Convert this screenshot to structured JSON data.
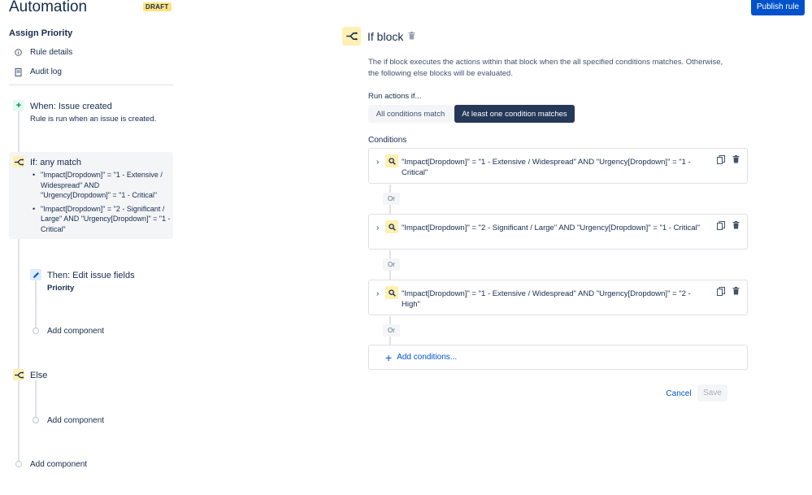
{
  "header": {
    "title": "Automation",
    "badge": "DRAFT",
    "publish_label": "Publish rule"
  },
  "sidebar": {
    "rule_name": "Assign Priority",
    "nav": [
      {
        "label": "Rule details",
        "icon": "info-icon"
      },
      {
        "label": "Audit log",
        "icon": "document-icon"
      }
    ]
  },
  "flow": {
    "trigger": {
      "title": "When: Issue created",
      "subtitle": "Rule is run when an issue is created."
    },
    "if_block": {
      "title": "If: any match",
      "conditions": [
        "\"Impact[Dropdown]\" = \"1 - Extensive / Widespread\" AND \"Urgency[Dropdown]\" = \"1 - Critical\"",
        "\"Impact[Dropdown]\" = \"2 - Significant / Large\" AND \"Urgency[Dropdown]\" = \"1 - Critical\""
      ]
    },
    "action": {
      "title": "Then: Edit issue fields",
      "subtitle": "Priority"
    },
    "add_component_1": "Add component",
    "else_title": "Else",
    "add_component_2": "Add component",
    "add_component_3": "Add component"
  },
  "panel": {
    "title": "If block",
    "description": "The if block executes the actions within that block when the all specified conditions matches. Otherwise, the following else blocks will be evaluated.",
    "run_label": "Run actions if...",
    "options": [
      "All conditions match",
      "At least one condition matches"
    ],
    "selected_option": "At least one condition matches",
    "conditions_label": "Conditions",
    "conditions": [
      "\"Impact[Dropdown]\" = \"1 - Extensive / Widespread\" AND \"Urgency[Dropdown]\" = \"1 - Critical\"",
      "\"Impact[Dropdown]\" = \"2 - Significant / Large\" AND \"Urgency[Dropdown]\" = \"1 - Critical\"",
      "\"Impact[Dropdown]\" = \"1 - Extensive / Widespread\" AND \"Urgency[Dropdown]\" = \"2 - High\""
    ],
    "or_label": "Or",
    "add_conditions": "Add conditions...",
    "cancel": "Cancel",
    "save": "Save"
  },
  "colors": {
    "primary": "#0052cc",
    "selected_segment": "#253858",
    "condition_icon_bg": "#fff0b3",
    "trigger_icon": "#00875a",
    "draft_badge": "#ffe380"
  }
}
